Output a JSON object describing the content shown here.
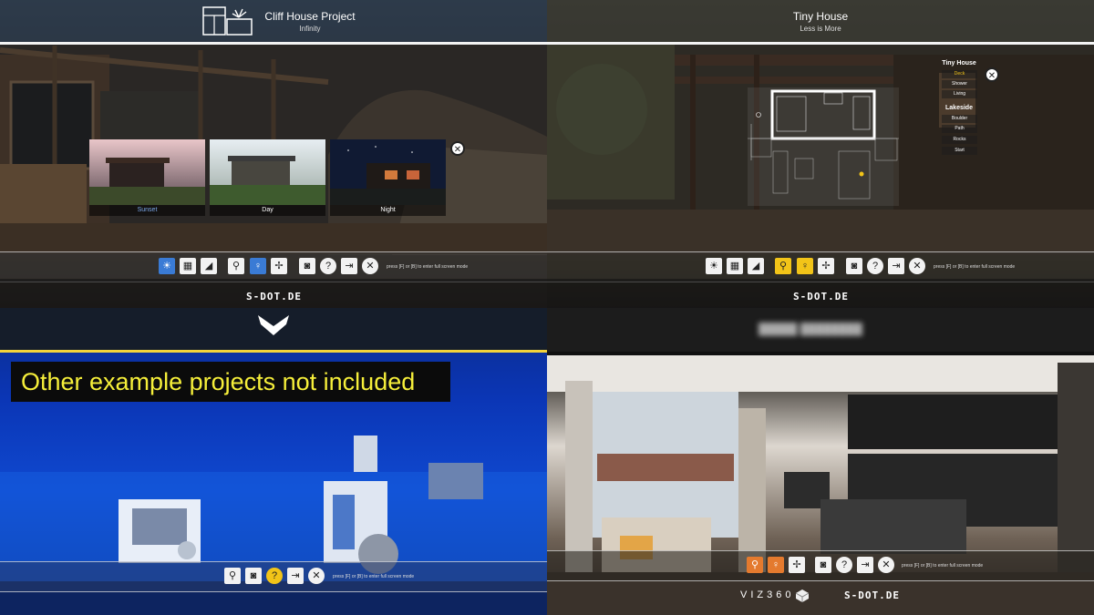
{
  "panels": {
    "cliff_house": {
      "title": "Cliff House Project",
      "subtitle": "Infinity",
      "thumbnails": [
        {
          "label": "Sunset",
          "label_color": "#7aa7e8"
        },
        {
          "label": "Day",
          "label_color": "#ffffff"
        },
        {
          "label": "Night",
          "label_color": "#ffffff"
        }
      ],
      "toolbar_hint": "press [F] or [B] to enter full screen mode",
      "logo": "S-DOT.DE"
    },
    "tiny_house": {
      "title": "Tiny House",
      "subtitle": "Less is More",
      "menu": {
        "groups": [
          {
            "heading": "Tiny House",
            "items": [
              "Deck",
              "Shower",
              "Living"
            ],
            "selected": "Deck"
          },
          {
            "heading": "Lakeside",
            "items": [
              "Boulder",
              "Path",
              "Rocks",
              "Start"
            ]
          }
        ]
      },
      "toolbar_hint": "press [F] or [B] to enter full screen mode",
      "logo": "S-DOT.DE"
    },
    "underwater": {
      "notice": "Other example projects not included",
      "toolbar_hint": "press [F] or [B] to enter full screen mode"
    },
    "apartment": {
      "toolbar_hint": "press [F] or [B] to enter full screen mode",
      "brand": "VIZ360",
      "logo": "S-DOT.DE"
    }
  },
  "icons": {
    "sun": "sun-icon",
    "layers": "layers-icon",
    "paint": "paint-bucket-icon",
    "pin": "location-pin-icon",
    "person": "person-icon",
    "drone": "drone-icon",
    "camera": "camera-icon",
    "help": "help-icon",
    "exit": "exit-icon",
    "close": "close-icon"
  },
  "colors": {
    "active_blue": "#3a7bd5",
    "highlight_yellow": "#f2c418",
    "accent_orange": "#e47a2e",
    "notice_text": "#f6ef3a"
  }
}
